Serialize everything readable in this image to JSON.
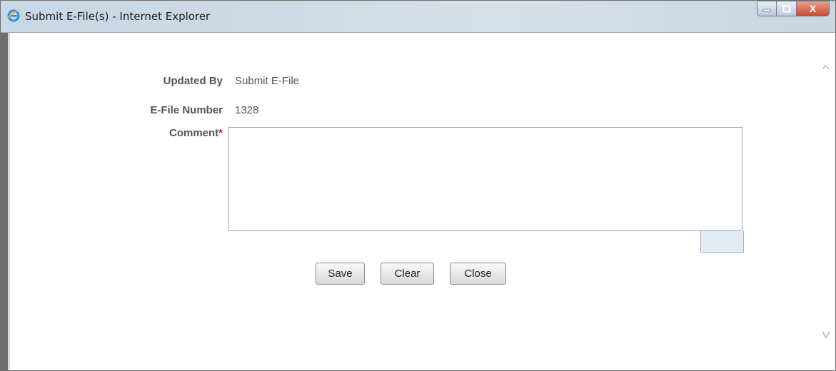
{
  "window": {
    "title": "Submit E-File(s) - Internet Explorer",
    "close_glyph": "X",
    "icons": [
      "ie-icon",
      "minimize-icon",
      "maximize-icon",
      "close-icon"
    ]
  },
  "form": {
    "updated_by_label": "Updated By",
    "updated_by_value": "Submit E-File",
    "efile_number_label": "E-File Number",
    "efile_number_value": "1328",
    "comment_label": "Comment",
    "required_marker": "*",
    "comment_value": ""
  },
  "buttons": {
    "save": "Save",
    "clear": "Clear",
    "close": "Close"
  },
  "scroll": {
    "up_glyph": "^",
    "down_glyph": "v"
  },
  "colors": {
    "required": "#c62828",
    "label_text": "#555555",
    "textarea_border": "#8fa6c2"
  }
}
